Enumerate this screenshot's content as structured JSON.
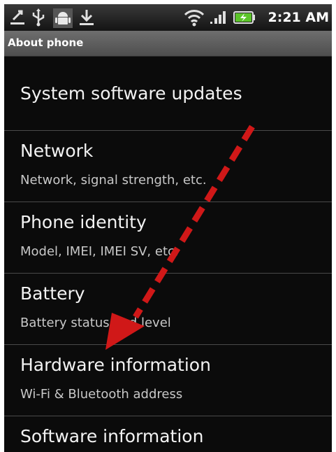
{
  "status_bar": {
    "icons": [
      "usb-debug-icon",
      "usb-icon",
      "android-icon",
      "download-icon",
      "wifi-icon",
      "signal-icon",
      "battery-charging-icon"
    ],
    "time": "2:21 AM"
  },
  "header": {
    "title": "About phone"
  },
  "items": [
    {
      "title": "System software updates",
      "summary": ""
    },
    {
      "title": "Network",
      "summary": "Network, signal strength, etc."
    },
    {
      "title": "Phone identity",
      "summary": "Model, IMEI, IMEI SV, etc."
    },
    {
      "title": "Battery",
      "summary": "Battery status and level"
    },
    {
      "title": "Hardware information",
      "summary": "Wi-Fi & Bluetooth address"
    },
    {
      "title": "Software information",
      "summary": ""
    }
  ],
  "annotation": {
    "icon": "red-dashed-arrow-icon",
    "color": "#d01818"
  },
  "colors": {
    "battery": "#5cc52a",
    "background": "#0b0b0b"
  }
}
